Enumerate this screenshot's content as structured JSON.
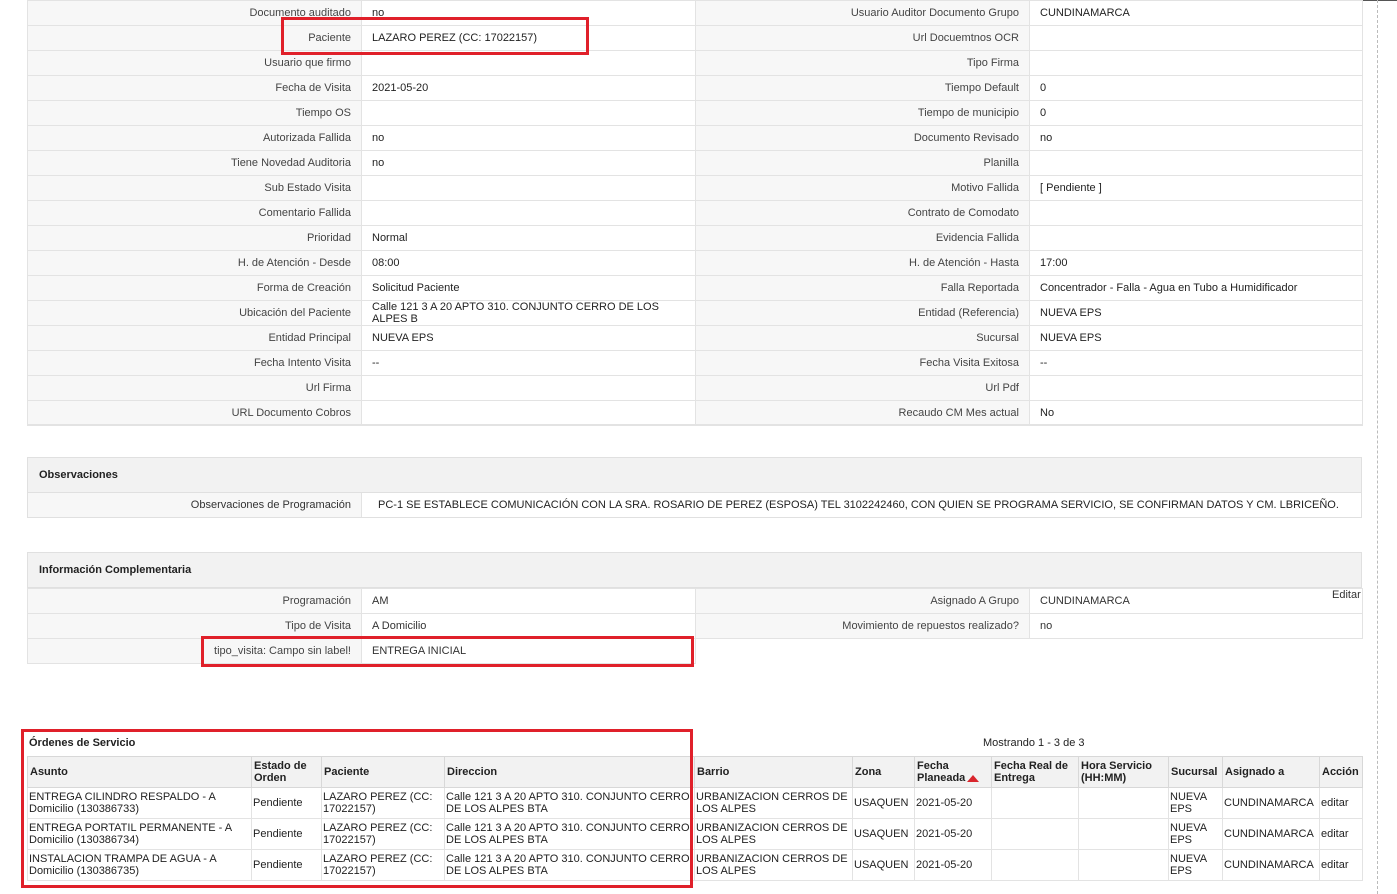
{
  "details": [
    {
      "l1": "Documento auditado",
      "v1": "no",
      "l2": "Usuario Auditor Documento Grupo",
      "v2": "CUNDINAMARCA"
    },
    {
      "l1": "Paciente",
      "v1": "LAZARO PEREZ (CC: 17022157)",
      "l2": "Url Docuemtnos OCR",
      "v2": ""
    },
    {
      "l1": "Usuario que firmo",
      "v1": "",
      "l2": "Tipo Firma",
      "v2": ""
    },
    {
      "l1": "Fecha de Visita",
      "v1": "2021-05-20",
      "l2": "Tiempo Default",
      "v2": "0"
    },
    {
      "l1": "Tiempo OS",
      "v1": "",
      "l2": "Tiempo de municipio",
      "v2": "0"
    },
    {
      "l1": "Autorizada Fallida",
      "v1": "no",
      "l2": "Documento Revisado",
      "v2": "no"
    },
    {
      "l1": "Tiene Novedad Auditoria",
      "v1": "no",
      "l2": "Planilla",
      "v2": ""
    },
    {
      "l1": "Sub Estado Visita",
      "v1": "",
      "l2": "Motivo Fallida",
      "v2": "[ Pendiente ]"
    },
    {
      "l1": "Comentario Fallida",
      "v1": "",
      "l2": "Contrato de Comodato",
      "v2": ""
    },
    {
      "l1": "Prioridad",
      "v1": "Normal",
      "l2": "Evidencia Fallida",
      "v2": ""
    },
    {
      "l1": "H. de Atención - Desde",
      "v1": "08:00",
      "l2": "H. de Atención - Hasta",
      "v2": "17:00"
    },
    {
      "l1": "Forma de Creación",
      "v1": "Solicitud Paciente",
      "l2": "Falla Reportada",
      "v2": "Concentrador - Falla - Agua en Tubo a Humidificador"
    },
    {
      "l1": "Ubicación del Paciente",
      "v1": "Calle 121 3 A 20 APTO 310. CONJUNTO CERRO DE LOS ALPES B",
      "l2": "Entidad (Referencia)",
      "v2": "NUEVA EPS"
    },
    {
      "l1": "Entidad Principal",
      "v1": "NUEVA EPS",
      "l2": "Sucursal",
      "v2": "NUEVA EPS"
    },
    {
      "l1": "Fecha Intento Visita",
      "v1": "--",
      "l2": "Fecha Visita Exitosa",
      "v2": "--"
    },
    {
      "l1": "Url Firma",
      "v1": "",
      "l2": "Url Pdf",
      "v2": ""
    },
    {
      "l1": "URL Documento Cobros",
      "v1": "",
      "l2": "Recaudo CM Mes actual",
      "v2": "No"
    }
  ],
  "observaciones": {
    "title": "Observaciones",
    "label": "Observaciones de Programación",
    "value": "PC-1 SE ESTABLECE COMUNICACIÓN CON LA SRA. ROSARIO DE PEREZ (ESPOSA) TEL 3102242460, CON QUIEN SE PROGRAMA SERVICIO, SE CONFIRMAN DATOS Y CM. LBRICEÑO."
  },
  "complementaria": {
    "title": "Información Complementaria",
    "edit_label": "Editar",
    "rows": [
      {
        "l1": "Programación",
        "v1": "AM",
        "l2": "Asignado A Grupo",
        "v2": "CUNDINAMARCA"
      },
      {
        "l1": "Tipo de Visita",
        "v1": "A Domicilio",
        "l2": "Movimiento de repuestos realizado?",
        "v2": "no"
      },
      {
        "l1": "tipo_visita: Campo sin label!",
        "v1": "ENTREGA INICIAL"
      }
    ]
  },
  "orders": {
    "title": "Órdenes de Servicio",
    "showing": "Mostrando 1 - 3 de 3",
    "headers": [
      "Asunto",
      "Estado de Orden",
      "Paciente",
      "Direccion",
      "Barrio",
      "Zona",
      "Fecha Planeada",
      "Fecha Real de Entrega",
      "Hora Servicio (HH:MM)",
      "Sucursal",
      "Asignado a",
      "Acción"
    ],
    "rows": [
      {
        "asunto": "ENTREGA CILINDRO RESPALDO - A Domicilio (130386733)",
        "estado": "Pendiente",
        "paciente": "LAZARO PEREZ (CC: 17022157)",
        "direccion": "Calle 121 3 A 20 APTO 310. CONJUNTO CERRO DE LOS ALPES BTA",
        "barrio": "URBANIZACION CERROS DE LOS ALPES",
        "zona": "USAQUEN",
        "fecha": "2021-05-20",
        "fecha_real": "",
        "hora": "",
        "sucursal": "NUEVA EPS",
        "asignado": "CUNDINAMARCA",
        "accion": "editar"
      },
      {
        "asunto": "ENTREGA PORTATIL PERMANENTE - A Domicilio (130386734)",
        "estado": "Pendiente",
        "paciente": "LAZARO PEREZ (CC: 17022157)",
        "direccion": "Calle 121 3 A 20 APTO 310. CONJUNTO CERRO DE LOS ALPES BTA",
        "barrio": "URBANIZACION CERROS DE LOS ALPES",
        "zona": "USAQUEN",
        "fecha": "2021-05-20",
        "fecha_real": "",
        "hora": "",
        "sucursal": "NUEVA EPS",
        "asignado": "CUNDINAMARCA",
        "accion": "editar"
      },
      {
        "asunto": "INSTALACION TRAMPA DE AGUA - A Domicilio (130386735)",
        "estado": "Pendiente",
        "paciente": "LAZARO PEREZ (CC: 17022157)",
        "direccion": "Calle 121 3 A 20 APTO 310. CONJUNTO CERRO DE LOS ALPES BTA",
        "barrio": "URBANIZACION CERROS DE LOS ALPES",
        "zona": "USAQUEN",
        "fecha": "2021-05-20",
        "fecha_real": "",
        "hora": "",
        "sucursal": "NUEVA EPS",
        "asignado": "CUNDINAMARCA",
        "accion": "editar"
      }
    ]
  },
  "colors": {
    "highlight": "#e0202a",
    "sort_arrow": "#d9262d"
  }
}
